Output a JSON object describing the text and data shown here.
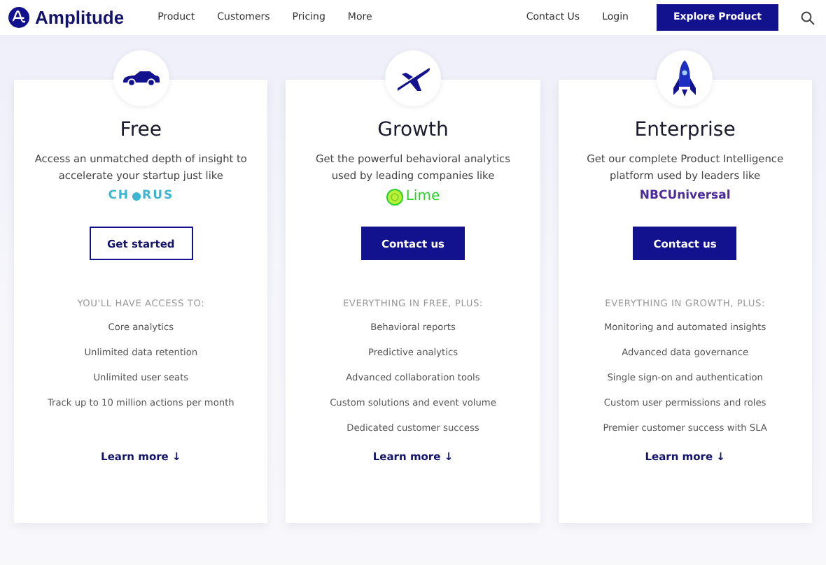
{
  "nav": {
    "brand": "Amplitude",
    "links": [
      "Product",
      "Customers",
      "Pricing",
      "More"
    ],
    "right_links": [
      "Contact Us",
      "Login"
    ],
    "cta": "Explore Product"
  },
  "plans": [
    {
      "title": "Free",
      "description": "Access an unmatched depth of insight to accelerate your startup just like",
      "logo": {
        "kind": "chorus",
        "text": "CH",
        "text_after": "RUS"
      },
      "button": {
        "label": "Get started",
        "kind": "outline"
      },
      "features_heading": "YOU'LL HAVE ACCESS TO:",
      "features": [
        "Core analytics",
        "Unlimited data retention",
        "Unlimited user seats",
        "Track up to 10 million actions per month"
      ],
      "learn_more": "Learn more ↓"
    },
    {
      "title": "Growth",
      "description": "Get the powerful behavioral analytics used by leading companies like",
      "logo": {
        "kind": "lime",
        "text": "Lime"
      },
      "button": {
        "label": "Contact us",
        "kind": "solid"
      },
      "features_heading": "EVERYTHING IN FREE, PLUS:",
      "features": [
        "Behavioral reports",
        "Predictive analytics",
        "Advanced collaboration tools",
        "Custom solutions and event volume",
        "Dedicated customer success"
      ],
      "learn_more": "Learn more ↓"
    },
    {
      "title": "Enterprise",
      "description": "Get our complete Product Intelligence platform used by leaders like",
      "logo": {
        "kind": "wordmark",
        "text": "NBCUniversal"
      },
      "button": {
        "label": "Contact us",
        "kind": "solid"
      },
      "features_heading": "EVERYTHING IN GROWTH, PLUS:",
      "features": [
        "Monitoring and automated insights",
        "Advanced data governance",
        "Single sign-on and authentication",
        "Custom user permissions and roles",
        "Premier customer success with SLA"
      ],
      "learn_more": "Learn more ↓"
    }
  ]
}
